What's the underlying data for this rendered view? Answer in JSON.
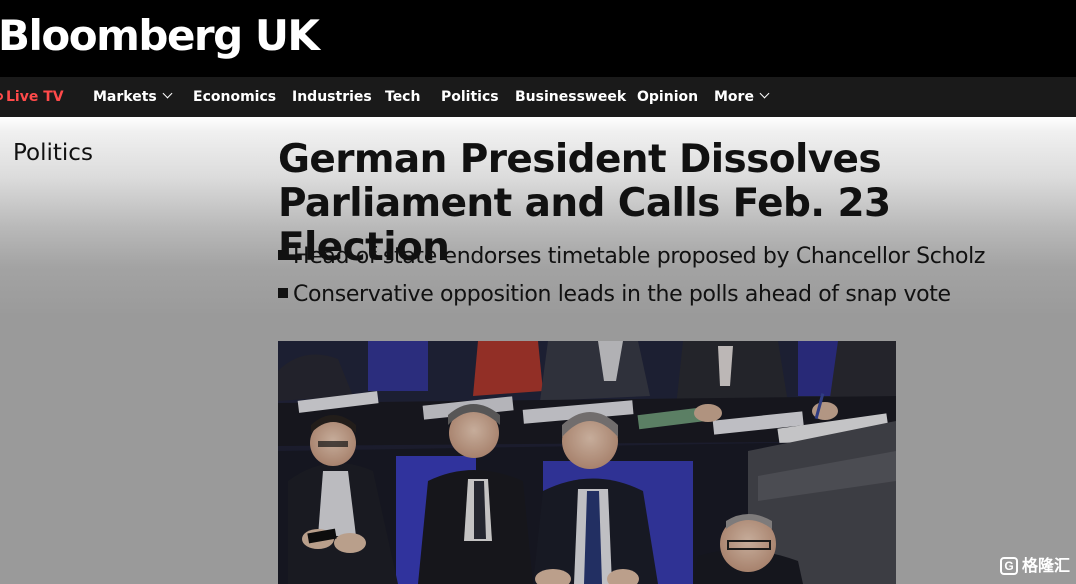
{
  "site": {
    "logo": "Bloomberg UK"
  },
  "nav": {
    "live_tv": "Live TV",
    "items": [
      "Markets",
      "Economics",
      "Industries",
      "Tech",
      "Politics",
      "Businessweek",
      "Opinion",
      "More"
    ]
  },
  "section": {
    "label": "Politics"
  },
  "article": {
    "headline_line1": "German President Dissolves",
    "headline_line2": "Parliament and Calls Feb. 23 Election",
    "summary": [
      "Head of state endorses timetable proposed by Chancellor Scholz",
      "Conservative opposition leads in the polls ahead of snap vote"
    ]
  },
  "watermark": {
    "text": "格隆汇",
    "glyph": "G"
  },
  "colors": {
    "masthead": "#000000",
    "navbar": "#1a1a1a",
    "live": "#ff4a4a",
    "text": "#111111"
  },
  "icons": {
    "nav_dropdown": "chevron-down-icon",
    "live": "live-dot-icon",
    "photo_alt": "photo of German parliament members seated in the Bundestag"
  }
}
